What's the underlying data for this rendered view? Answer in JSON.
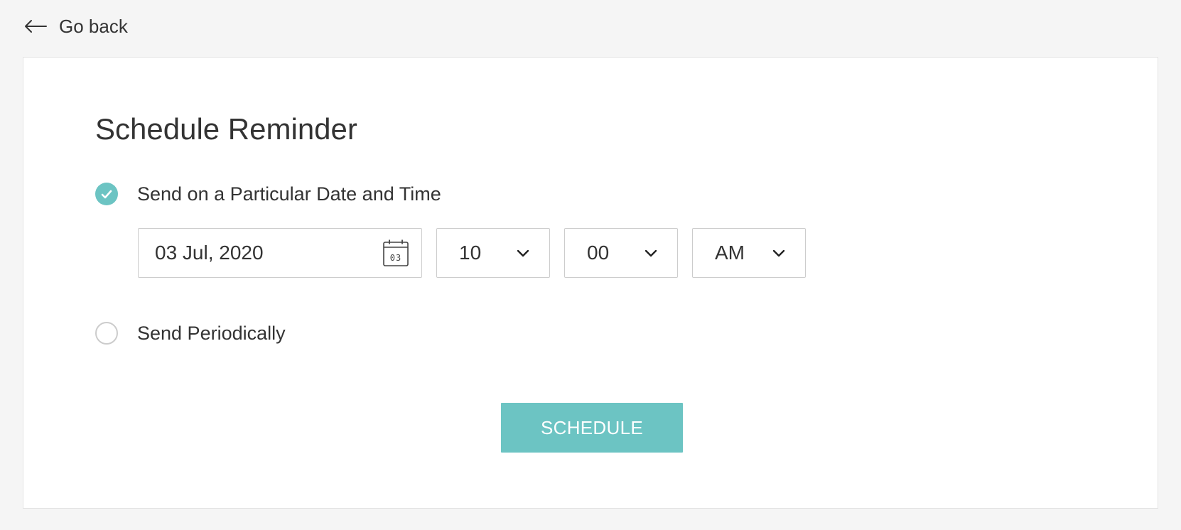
{
  "nav": {
    "back_label": "Go back"
  },
  "form": {
    "title": "Schedule Reminder",
    "option_particular": {
      "label": "Send on a Particular Date and Time",
      "checked": true
    },
    "date": {
      "value": "03 Jul, 2020",
      "calendar_icon_day": "03"
    },
    "hour": {
      "value": "10"
    },
    "minute": {
      "value": "00"
    },
    "meridiem": {
      "value": "AM"
    },
    "option_periodic": {
      "label": "Send Periodically",
      "checked": false
    },
    "schedule_label": "SCHEDULE"
  },
  "colors": {
    "accent": "#6cc4c3",
    "background": "#f5f5f5",
    "card": "#ffffff",
    "text": "#333333",
    "border": "#cccccc"
  },
  "icons": {
    "back": "arrow-left-icon",
    "checked_radio": "check-icon",
    "calendar": "calendar-icon",
    "select": "chevron-down-icon"
  }
}
